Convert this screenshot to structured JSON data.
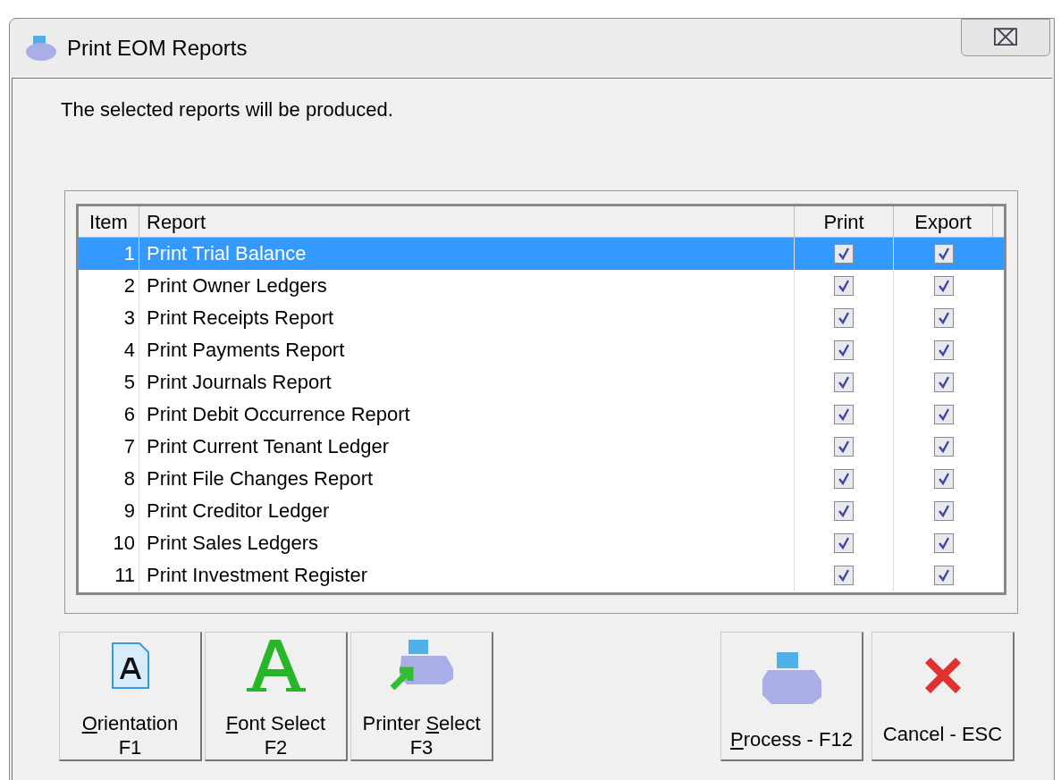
{
  "window": {
    "title": "Print EOM Reports",
    "close": "⌧"
  },
  "message": "The selected reports will be produced.",
  "table": {
    "columns": [
      "Item",
      "Report",
      "Print",
      "Export"
    ],
    "rows": [
      {
        "item": "1",
        "report": "Print Trial Balance",
        "print": true,
        "export": true,
        "selected": true
      },
      {
        "item": "2",
        "report": "Print Owner Ledgers",
        "print": true,
        "export": true,
        "selected": false
      },
      {
        "item": "3",
        "report": "Print Receipts Report",
        "print": true,
        "export": true,
        "selected": false
      },
      {
        "item": "4",
        "report": "Print Payments Report",
        "print": true,
        "export": true,
        "selected": false
      },
      {
        "item": "5",
        "report": "Print Journals Report",
        "print": true,
        "export": true,
        "selected": false
      },
      {
        "item": "6",
        "report": "Print Debit Occurrence Report",
        "print": true,
        "export": true,
        "selected": false
      },
      {
        "item": "7",
        "report": "Print Current Tenant Ledger",
        "print": true,
        "export": true,
        "selected": false
      },
      {
        "item": "8",
        "report": "Print File Changes Report",
        "print": true,
        "export": true,
        "selected": false
      },
      {
        "item": "9",
        "report": "Print Creditor Ledger",
        "print": true,
        "export": true,
        "selected": false
      },
      {
        "item": "10",
        "report": "Print Sales Ledgers",
        "print": true,
        "export": true,
        "selected": false
      },
      {
        "item": "11",
        "report": "Print Investment Register",
        "print": true,
        "export": true,
        "selected": false
      }
    ]
  },
  "buttons": [
    {
      "kind": "orientation",
      "label": {
        "key": "O",
        "after": "rientation"
      },
      "shortcut": "F1"
    },
    {
      "kind": "font",
      "label": {
        "key": "F",
        "after": "ont Select"
      },
      "shortcut": "F2"
    },
    {
      "kind": "printer-select",
      "label": {
        "before": "Printer ",
        "key": "S",
        "after": "elect"
      },
      "shortcut": "F3"
    }
  ],
  "actions": [
    {
      "kind": "process",
      "label": {
        "key": "P",
        "after": "rocess - F12"
      }
    },
    {
      "kind": "cancel",
      "label": {
        "before": "Cancel - ESC"
      }
    }
  ]
}
